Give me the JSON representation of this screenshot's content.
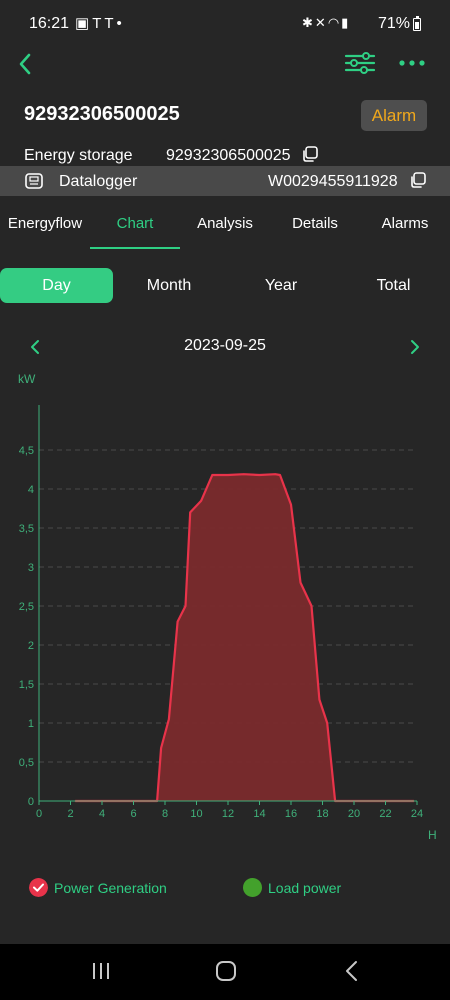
{
  "status_bar": {
    "time": "16:21",
    "notification_icons": [
      "gallery-icon",
      "tesla-icon",
      "tesla-icon",
      "dot-icon"
    ],
    "system_icons": [
      "bluetooth-icon",
      "mute-icon",
      "wifi-icon",
      "signal-icon"
    ],
    "battery": "71%"
  },
  "header": {
    "back_icon": "chevron-left-icon",
    "filter_icon": "sliders-icon",
    "more_icon": "more-dots-icon",
    "title": "92932306500025",
    "alarm_label": "Alarm"
  },
  "info": {
    "storage_label": "Energy storage",
    "storage_value": "92932306500025",
    "logger_label": "Datalogger",
    "logger_value": "W0029455911928"
  },
  "tabs": [
    {
      "label": "Energyflow",
      "active": false
    },
    {
      "label": "Chart",
      "active": true
    },
    {
      "label": "Analysis",
      "active": false
    },
    {
      "label": "Details",
      "active": false
    },
    {
      "label": "Alarms",
      "active": false
    }
  ],
  "periods": [
    {
      "label": "Day",
      "active": true
    },
    {
      "label": "Month",
      "active": false
    },
    {
      "label": "Year",
      "active": false
    },
    {
      "label": "Total",
      "active": false
    }
  ],
  "date": "2023-09-25",
  "colors": {
    "accent": "#2fcf84",
    "period_active": "#34cc83",
    "alarm_text": "#f0a81c",
    "generation": "#e8334a",
    "generation_fill": "#7a2a2c",
    "load": "#43a12c",
    "axis": "#3fb07a",
    "background": "#262626"
  },
  "chart_data": {
    "type": "area",
    "title": "",
    "xlabel": "H",
    "ylabel": "kW",
    "xlim": [
      0,
      24
    ],
    "ylim": [
      0,
      5
    ],
    "x_ticks": [
      "0",
      "2",
      "4",
      "6",
      "8",
      "10",
      "12",
      "14",
      "16",
      "18",
      "20",
      "22",
      "24"
    ],
    "y_ticks": [
      "0",
      "0,5",
      "1",
      "1,5",
      "2",
      "2,5",
      "3",
      "3,5",
      "4",
      "4,5"
    ],
    "grid": true,
    "legend_placement": "bottom",
    "series": [
      {
        "name": "Power Generation",
        "x": [
          2.3,
          7.5,
          7.75,
          8.25,
          8.8,
          9.3,
          9.6,
          10.3,
          11.0,
          12.0,
          13.0,
          14.0,
          15.0,
          15.3,
          16.0,
          16.6,
          17.3,
          17.8,
          18.3,
          18.8,
          23.8
        ],
        "y": [
          0,
          0,
          0.68,
          1.05,
          2.3,
          2.5,
          3.7,
          3.85,
          4.18,
          4.18,
          4.19,
          4.18,
          4.19,
          4.18,
          3.8,
          2.8,
          2.5,
          1.3,
          1.0,
          0,
          0
        ]
      },
      {
        "name": "Load power",
        "x": [],
        "y": []
      }
    ]
  },
  "nav": [
    "recent-apps-icon",
    "home-icon",
    "back-icon"
  ]
}
